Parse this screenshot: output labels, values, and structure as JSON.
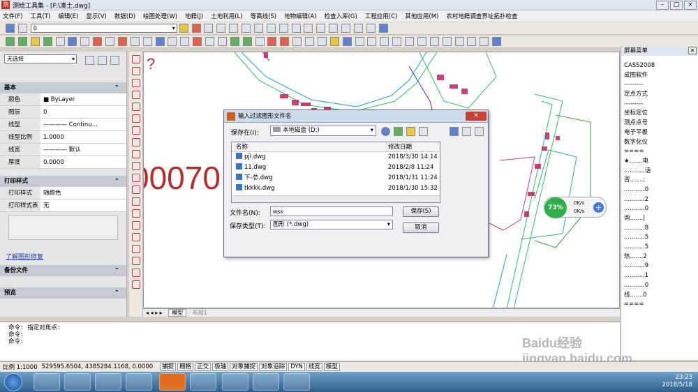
{
  "app": {
    "title": "测绘工具集 - [F:\\凑土.dwg]"
  },
  "menu": [
    "文件(F)",
    "工具(T)",
    "编辑(E)",
    "显示(V)",
    "数据(D)",
    "绘图处理(W)",
    "地籍(J)",
    "土地利用(L)",
    "等高线(S)",
    "地物编辑(A)",
    "检查入库(G)",
    "工程应用(C)",
    "其他应用(M)",
    "农村地籍调查界址拓扑检查"
  ],
  "toolbar": {
    "layer_value": "0"
  },
  "properties": {
    "selection": "无选择",
    "basic_title": "基本",
    "basic": [
      {
        "k": "颜色",
        "v": "■ ByLayer"
      },
      {
        "k": "图层",
        "v": "0"
      },
      {
        "k": "线型",
        "v": "———— Continu..."
      },
      {
        "k": "线型比例",
        "v": "1.0000"
      },
      {
        "k": "线宽",
        "v": "———— 默认"
      },
      {
        "k": "厚度",
        "v": "0.0000"
      }
    ],
    "print_title": "打印样式",
    "print": [
      {
        "k": "打印样式",
        "v": "随颜色"
      },
      {
        "k": "打印样式表",
        "v": "无"
      }
    ],
    "help_link": "了解图形修复",
    "backup_title": "备份文件",
    "preview_title": "预览"
  },
  "canvas": {
    "big_text": "00070",
    "question": "?"
  },
  "tabs": {
    "model": "模型",
    "layout": "布局1"
  },
  "dialog": {
    "title": "输入过滤图形文件名",
    "save_in_label": "保存在(I):",
    "save_in_value": "本地磁盘 (D:)",
    "col_name": "名称",
    "col_date": "修改日期",
    "files": [
      {
        "name": "pjl.dwg",
        "date": "2018/3/30 14:14"
      },
      {
        "name": "11.dwg",
        "date": "2018/2/8 11:24"
      },
      {
        "name": "下-总.dwg",
        "date": "2018/1/31 11:24"
      },
      {
        "name": "tkkkk.dwg",
        "date": "2018/1/30 15:32"
      }
    ],
    "filename_label": "文件名(N):",
    "filename_value": "wsx",
    "filetype_label": "保存类型(T):",
    "filetype_value": "图形 (*.dwg)",
    "save_button": "保存(S)",
    "cancel_button": "取消"
  },
  "screen_menu": {
    "title": "屏幕菜单",
    "items": [
      "CASS2008",
      "成图软件",
      "---------",
      "定点方式",
      "---------",
      "坐标定位",
      "测点点号",
      "电子平板",
      "数字化仪",
      "====",
      "★.......电",
      "...........话",
      "咨.......:",
      "...........0",
      "...........2",
      "...........0",
      "询.......|",
      "...........8",
      "...........5",
      "...........5",
      "热.......2",
      "...........9",
      "...........1",
      "...........0",
      "线.......0",
      "===="
    ]
  },
  "command": {
    "lines": [
      "命令: 指定对角点:",
      "命令:",
      "命令:"
    ]
  },
  "status": {
    "scale": "比例 1:1000",
    "coords": "529595.6504, 4385284.1168, 0.0000",
    "toggles": [
      "捕捉",
      "栅格",
      "正交",
      "极轴",
      "对象捕捉",
      "对象追踪",
      "DYN",
      "线宽",
      "模型"
    ]
  },
  "network": {
    "percent": "73%",
    "up": "0K/s",
    "down": "0K/s"
  },
  "clock": {
    "time": "23:23",
    "date": "2018/5/18"
  },
  "watermark": "Baidu经验 jingyan.baidu.com"
}
